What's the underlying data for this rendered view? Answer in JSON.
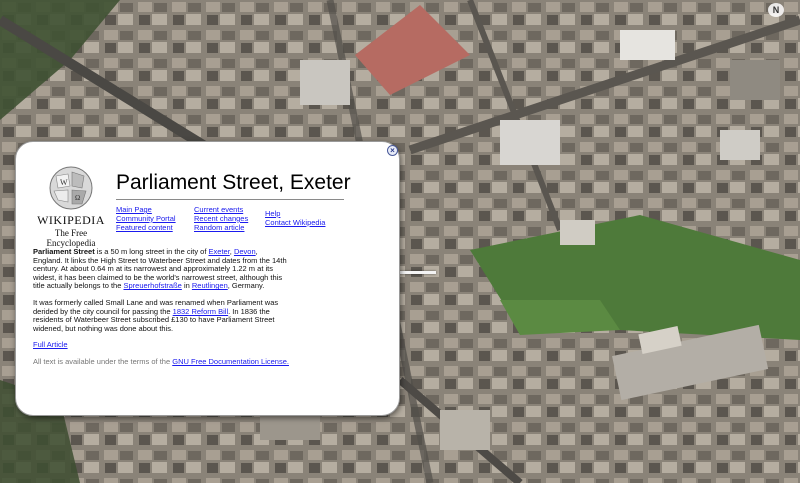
{
  "map": {
    "compass_label": "N"
  },
  "wiki": {
    "wordmark": "WIKIPEDIA",
    "tagline": "The Free Encyclopedia",
    "title": "Parliament Street, Exeter",
    "nav_col1": [
      "Main Page",
      "Community Portal",
      "Featured content"
    ],
    "nav_col2": [
      "Current events",
      "Recent changes",
      "Random article"
    ],
    "nav_col3": [
      "Help",
      "Contact Wikipedia"
    ],
    "p1": {
      "bold": "Parliament Street",
      "t1": " is a 50 m long street in the city of ",
      "l1": "Exeter",
      "t2": ", ",
      "l2": "Devon",
      "t3": ", England. It links the High Street to Waterbeer Street and dates from the 14th century. At about 0.64 m at its narrowest and approximately 1.22 m at its widest, it has been claimed to be the world's narrowest street, although this title actually belongs to the ",
      "l3": "Spreuerhofstraße",
      "t4": " in ",
      "l4": "Reutlingen",
      "t5": ", Germany."
    },
    "p2": {
      "t1": "It was formerly called Small Lane and was renamed when Parliament was derided by the city council for passing the ",
      "l1": "1832 Reform Bill",
      "t2": ". In 1836 the residents of Waterbeer Street subscribed £130 to have Parliament Street widened, but nothing was done about this."
    },
    "full_article": "Full Article",
    "license": {
      "t1": "All text is available under the terms of the ",
      "l1": "GNU Free Documentation License."
    },
    "close_glyph": "×"
  }
}
